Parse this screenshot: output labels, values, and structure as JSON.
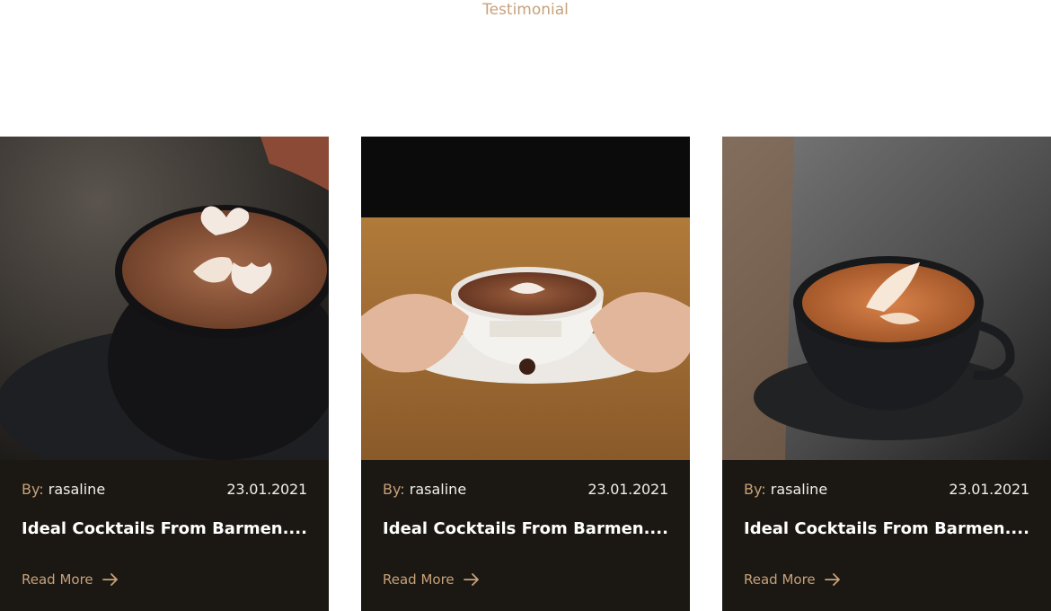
{
  "section": {
    "kicker": "Testimonial"
  },
  "posts": [
    {
      "by_prefix": "By:",
      "author": "rasaline",
      "date": "23.01.2021",
      "title": "Ideal Cocktails From Barmen....",
      "read_more": "Read More",
      "arrow_icon": "arrow-right-icon"
    },
    {
      "by_prefix": "By:",
      "author": "rasaline",
      "date": "23.01.2021",
      "title": "Ideal Cocktails From Barmen....",
      "read_more": "Read More",
      "arrow_icon": "arrow-right-icon"
    },
    {
      "by_prefix": "By:",
      "author": "rasaline",
      "date": "23.01.2021",
      "title": "Ideal Cocktails From Barmen....",
      "read_more": "Read More",
      "arrow_icon": "arrow-right-icon"
    }
  ],
  "colors": {
    "accent": "#c7a27a",
    "card_bg": "#1b1712",
    "text_light": "#f2eee9"
  }
}
